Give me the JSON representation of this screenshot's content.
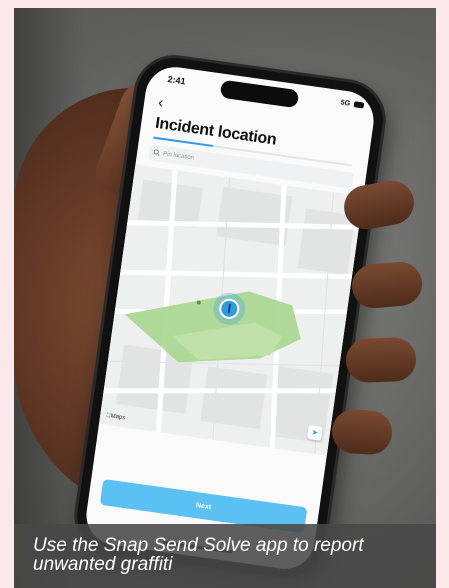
{
  "phone": {
    "status_time": "2:41",
    "status_network": "5G",
    "back_glyph": "‹",
    "title": "Incident location",
    "progress_fraction": 0.3,
    "search_icon": "search-icon",
    "search_placeholder": "Pin location",
    "maps_attribution": "Maps",
    "locate_icon": "navigation-arrow-icon",
    "next_label": "Next"
  },
  "caption": {
    "text": "Use the Snap Send Solve app to report unwanted graffiti"
  },
  "colors": {
    "accent": "#2f9be0",
    "button": "#5bc0f2",
    "park": "#a7d68f",
    "border": "#fbe8ea"
  }
}
